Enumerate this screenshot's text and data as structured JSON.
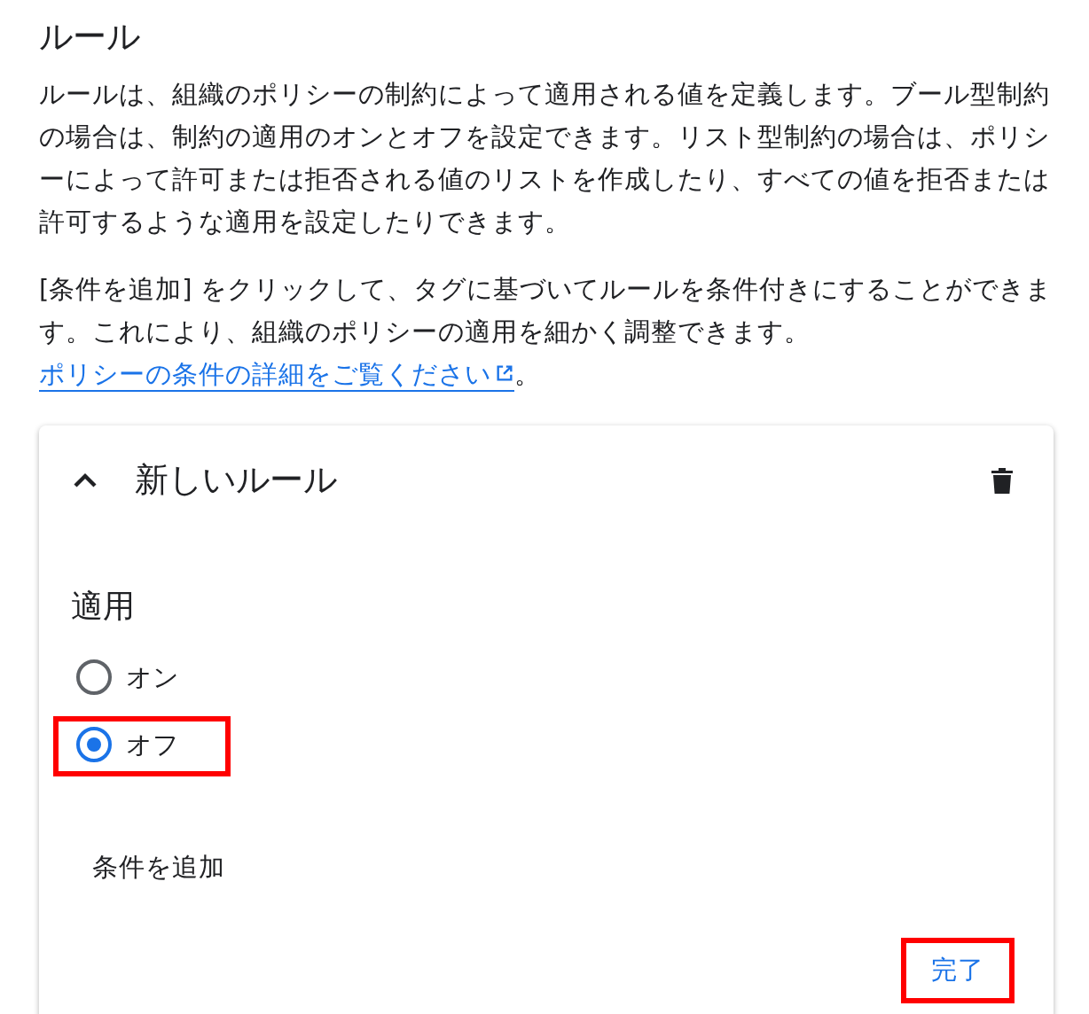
{
  "title": "ルール",
  "paragraphs": [
    {
      "text": "ルールは、組織のポリシーの制約によって適用される値を定義します。ブール型制約の場合は、制約の適用のオンとオフを設定できます。リスト型制約の場合は、ポリシーによって許可または拒否される値のリストを作成したり、すべての値を拒否または許可するような適用を設定したりできます。"
    },
    {
      "text": "[条件を追加] をクリックして、タグに基づいてルールを条件付きにすることができます。これにより、組織のポリシーの適用を細かく調整できます。",
      "link": "ポリシーの条件の詳細をご覧ください",
      "after": "。"
    }
  ],
  "rule_card": {
    "title": "新しいルール",
    "expanded": true,
    "section_label": "適用",
    "options": [
      {
        "label": "オン",
        "selected": false,
        "highlighted": false
      },
      {
        "label": "オフ",
        "selected": true,
        "highlighted": true
      }
    ],
    "add_condition_button": "条件を追加",
    "done_button": {
      "label": "完了",
      "highlighted": true
    }
  }
}
